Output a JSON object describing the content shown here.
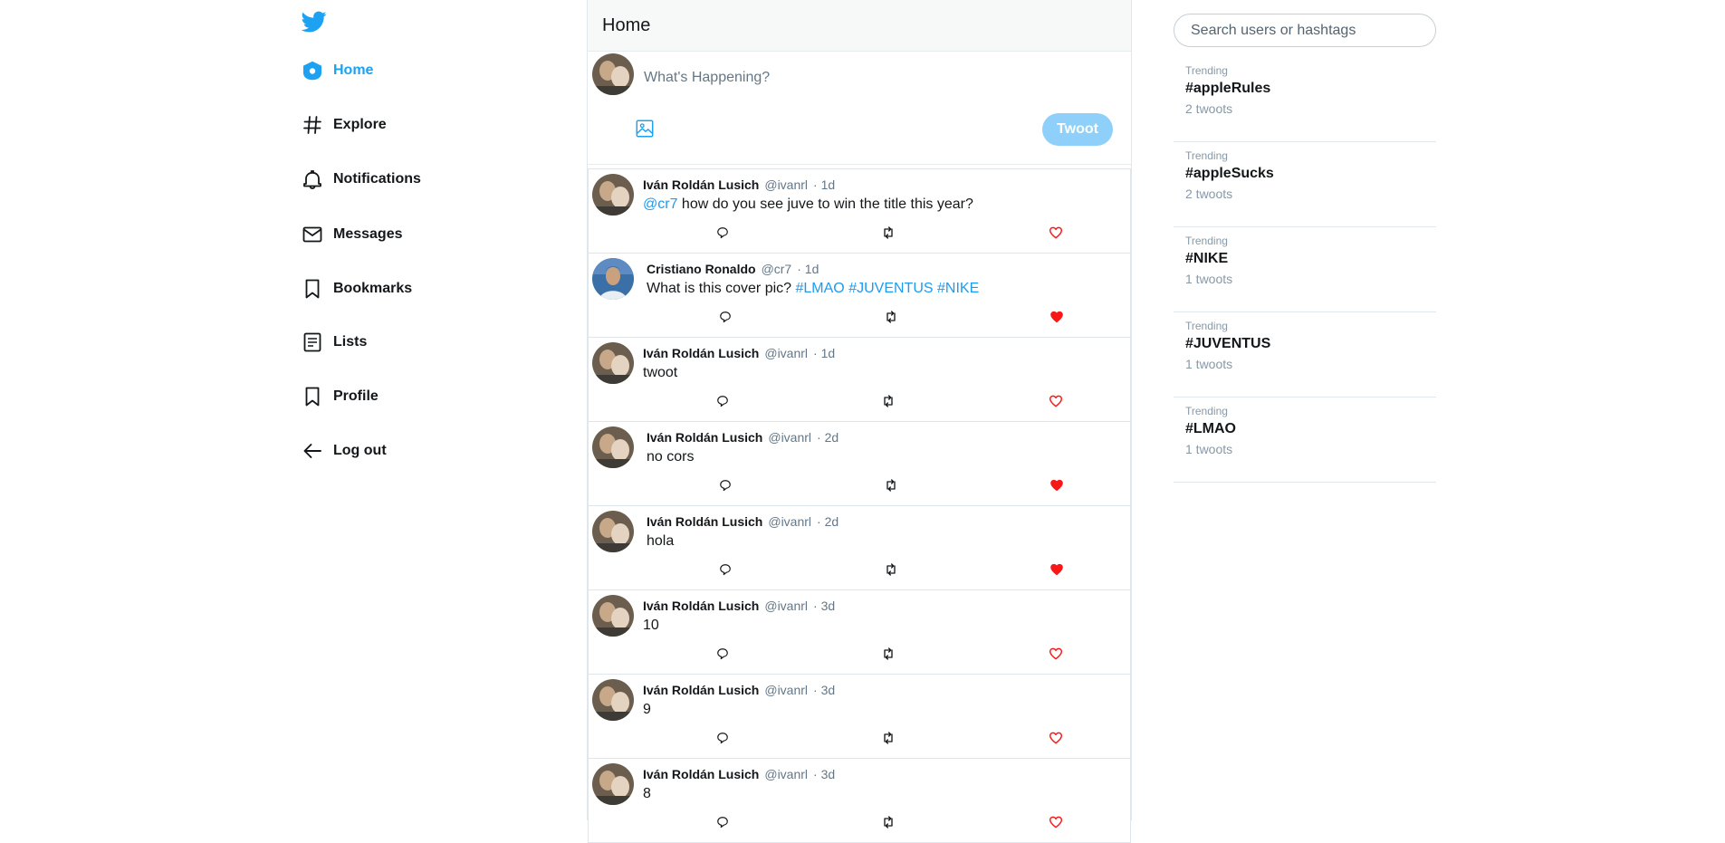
{
  "brand": {
    "accent": "#1da1f2",
    "like_color": "#f91818",
    "icon": "twitter-bird-icon"
  },
  "nav": {
    "items": [
      {
        "label": "Home",
        "icon": "home-icon",
        "active": true
      },
      {
        "label": "Explore",
        "icon": "hashtag-icon"
      },
      {
        "label": "Notifications",
        "icon": "bell-icon"
      },
      {
        "label": "Messages",
        "icon": "envelope-icon"
      },
      {
        "label": "Bookmarks",
        "icon": "bookmark-icon"
      },
      {
        "label": "Lists",
        "icon": "list-icon"
      },
      {
        "label": "Profile",
        "icon": "bookmark-icon"
      },
      {
        "label": "Log out",
        "icon": "arrow-left-icon"
      }
    ]
  },
  "header": {
    "title": "Home"
  },
  "composer": {
    "placeholder": "What's Happening?",
    "button_label": "Twoot",
    "media_icon": "image-icon"
  },
  "tweets": [
    {
      "name": "Iván Roldán Lusich",
      "handle": "@ivanrl",
      "time": "· 1d",
      "mention": "@cr7",
      "text": " how do you see juve to win the title this year?",
      "liked": false
    },
    {
      "name": "Cristiano Ronaldo",
      "handle": "@cr7",
      "time": "· 1d",
      "text": "What is this cover pic? ",
      "hashtags": [
        "#LMAO",
        "#JUVENTUS",
        "#NIKE"
      ],
      "liked": true
    },
    {
      "name": "Iván Roldán Lusich",
      "handle": "@ivanrl",
      "time": "· 1d",
      "text": "twoot",
      "liked": false
    },
    {
      "name": "Iván Roldán Lusich",
      "handle": "@ivanrl",
      "time": "· 2d",
      "text": "no cors",
      "liked": true
    },
    {
      "name": "Iván Roldán Lusich",
      "handle": "@ivanrl",
      "time": "· 2d",
      "text": "hola",
      "liked": true
    },
    {
      "name": "Iván Roldán Lusich",
      "handle": "@ivanrl",
      "time": "· 3d",
      "text": "10",
      "liked": false
    },
    {
      "name": "Iván Roldán Lusich",
      "handle": "@ivanrl",
      "time": "· 3d",
      "text": "9",
      "liked": false
    },
    {
      "name": "Iván Roldán Lusich",
      "handle": "@ivanrl",
      "time": "· 3d",
      "text": "8",
      "liked": false
    }
  ],
  "search": {
    "placeholder": "Search users or hashtags"
  },
  "trends": [
    {
      "label": "Trending",
      "tag": "#appleRules",
      "count": "2 twoots"
    },
    {
      "label": "Trending",
      "tag": "#appleSucks",
      "count": "2 twoots"
    },
    {
      "label": "Trending",
      "tag": "#NIKE",
      "count": "1 twoots"
    },
    {
      "label": "Trending",
      "tag": "#JUVENTUS",
      "count": "1 twoots"
    },
    {
      "label": "Trending",
      "tag": "#LMAO",
      "count": "1 twoots"
    }
  ]
}
